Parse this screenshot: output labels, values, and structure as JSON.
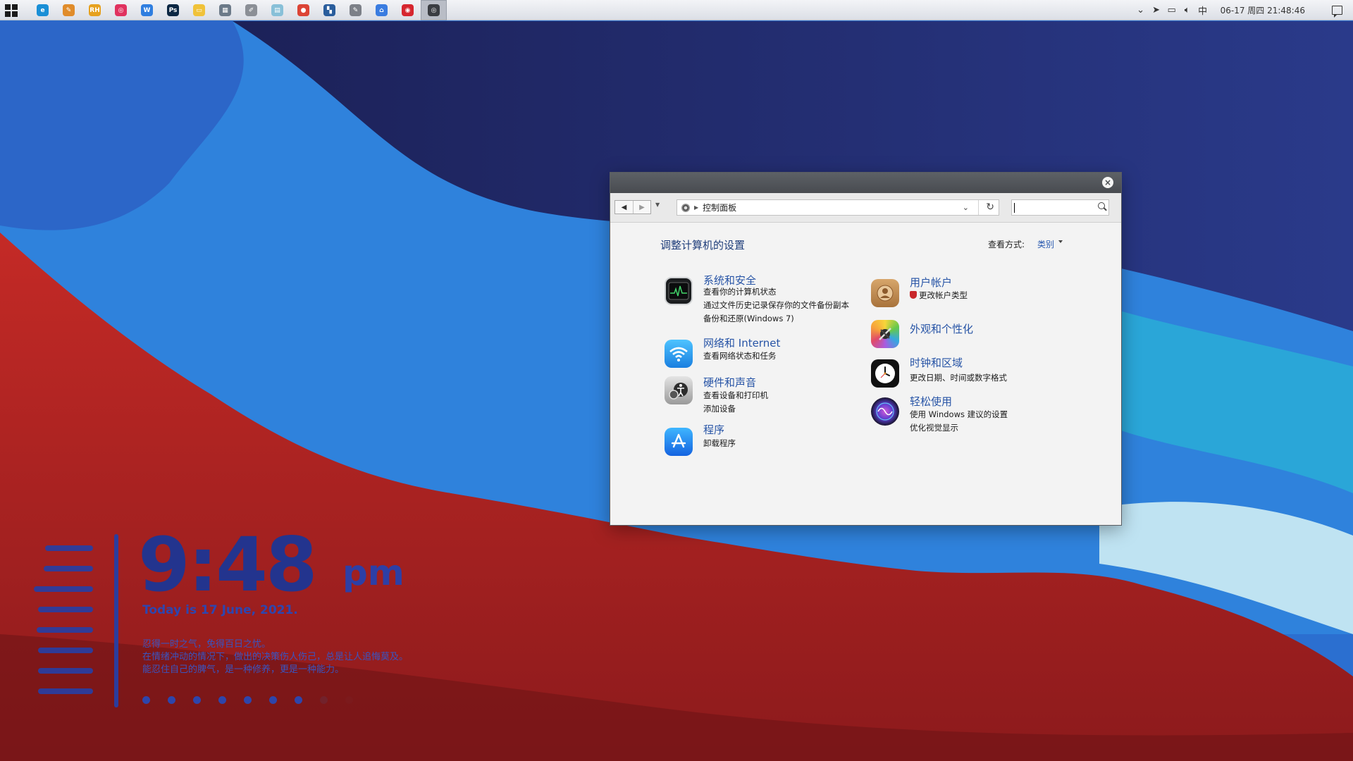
{
  "taskbar": {
    "apps": [
      {
        "name": "edge-app",
        "glyph": "e",
        "color": "#1a8fd6"
      },
      {
        "name": "paint-app",
        "glyph": "✎",
        "color": "#e08c2b"
      },
      {
        "name": "rh-app",
        "glyph": "RH",
        "color": "#e6a11f"
      },
      {
        "name": "instagram-app",
        "glyph": "◎",
        "color": "#e0325f"
      },
      {
        "name": "wps-writer-app",
        "glyph": "W",
        "color": "#2f7ee0"
      },
      {
        "name": "photoshop-app",
        "glyph": "Ps",
        "color": "#0b2743"
      },
      {
        "name": "file-explorer-app",
        "glyph": "▭",
        "color": "#f0c23a"
      },
      {
        "name": "calculator-app",
        "glyph": "▦",
        "color": "#6c7a89"
      },
      {
        "name": "notepad-app",
        "glyph": "✐",
        "color": "#8b8f96"
      },
      {
        "name": "document-app",
        "glyph": "▤",
        "color": "#88c0d8"
      },
      {
        "name": "chrome-app",
        "glyph": "●",
        "color": "#dc4436"
      },
      {
        "name": "settings-grid-app",
        "glyph": "▚",
        "color": "#2a5d9c"
      },
      {
        "name": "editor-app",
        "glyph": "✎",
        "color": "#7c8088"
      },
      {
        "name": "home-app",
        "glyph": "⌂",
        "color": "#3a7ce0"
      },
      {
        "name": "netease-music-app",
        "glyph": "◉",
        "color": "#d6262f"
      },
      {
        "name": "control-panel-app",
        "glyph": "◎",
        "color": "#3a3d42"
      }
    ],
    "tray": {
      "clock": "06-17 周四 21:48:46",
      "input_method": "中"
    }
  },
  "widget": {
    "time": "9:48",
    "ampm": "pm",
    "date": "Today is 17 June, 2021.",
    "quote": [
      "忍得一时之气，免得百日之忧。",
      "在情绪冲动的情况下，做出的决策伤人伤己，总是让人追悔莫及。",
      "能忍住自己的脾气，是一种修养，更是一种能力。"
    ]
  },
  "window": {
    "address_path": "控制面板",
    "search_value": "",
    "page_title": "调整计算机的设置",
    "view_by_label": "查看方式:",
    "view_by_value": "类别",
    "categories_left": [
      {
        "title": "系统和安全",
        "links": [
          "查看你的计算机状态",
          "通过文件历史记录保存你的文件备份副本",
          "备份和还原(Windows 7)"
        ]
      },
      {
        "title": "网络和 Internet",
        "links": [
          "查看网络状态和任务"
        ]
      },
      {
        "title": "硬件和声音",
        "links": [
          "查看设备和打印机",
          "添加设备"
        ]
      },
      {
        "title": "程序",
        "links": [
          "卸载程序"
        ]
      }
    ],
    "categories_right": [
      {
        "title": "用户帐户",
        "links": [
          "更改帐户类型"
        ]
      },
      {
        "title": "外观和个性化",
        "links": []
      },
      {
        "title": "时钟和区域",
        "links": [
          "更改日期、时间或数字格式"
        ]
      },
      {
        "title": "轻松使用",
        "links": [
          "使用 Windows 建议的设置",
          "优化视觉显示"
        ]
      }
    ]
  }
}
